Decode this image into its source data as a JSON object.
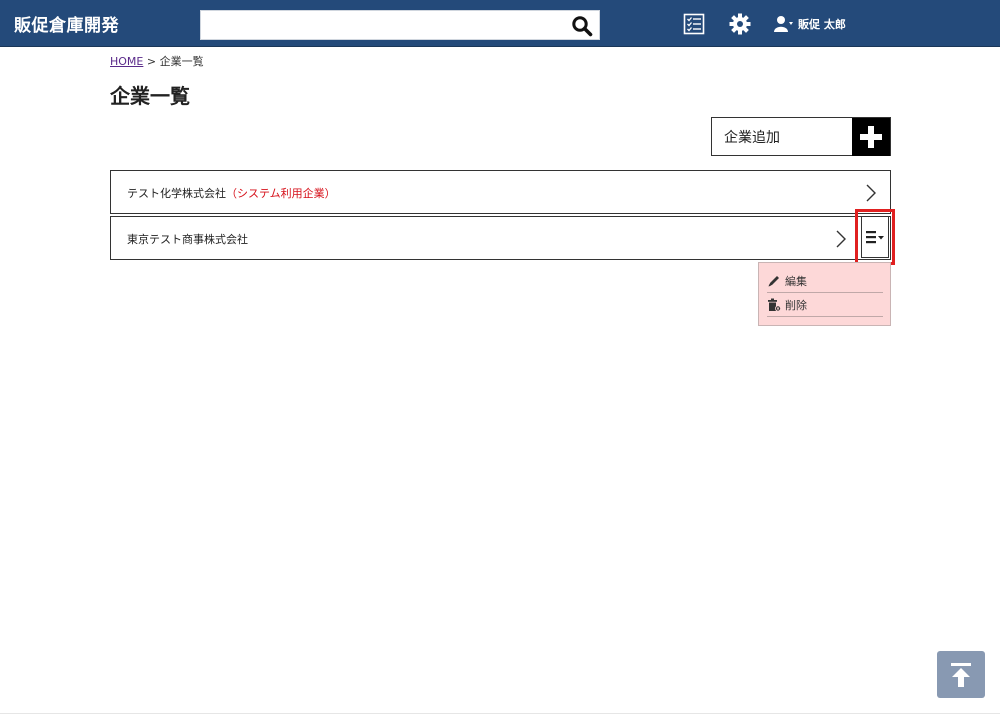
{
  "header": {
    "app_title": "販促倉庫開発",
    "search": {
      "value": "",
      "placeholder": ""
    },
    "user": {
      "name": "販促 太郎"
    }
  },
  "breadcrumb": {
    "home": "HOME",
    "separator": ">",
    "current": "企業一覧"
  },
  "page": {
    "title": "企業一覧"
  },
  "actions": {
    "add_label": "企業追加"
  },
  "companies": [
    {
      "name": "テスト化学株式会社",
      "note": "（システム利用企業）"
    },
    {
      "name": "東京テスト商事株式会社",
      "note": ""
    }
  ],
  "dropdown": {
    "items": [
      {
        "label": "編集",
        "icon": "pencil-icon"
      },
      {
        "label": "削除",
        "icon": "trash-icon"
      }
    ]
  },
  "colors": {
    "header_bg": "#244a7a",
    "accent_red": "#d6101a",
    "dropdown_bg": "#fdd8d8",
    "to_top_bg": "#8899b2"
  }
}
